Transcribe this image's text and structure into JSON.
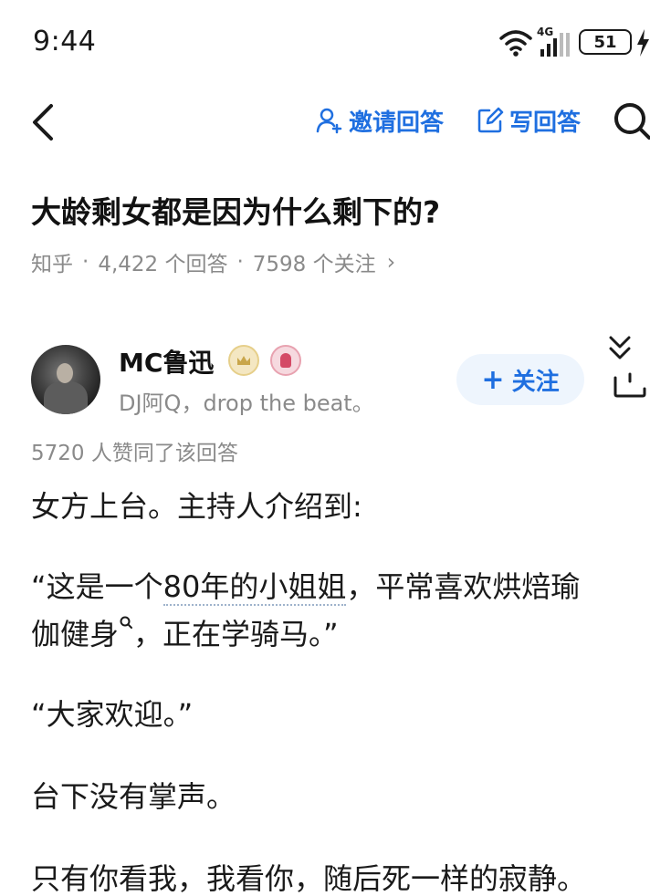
{
  "status_bar": {
    "time": "9:44",
    "network": "4G",
    "battery": "51"
  },
  "nav": {
    "invite_label": "邀请回答",
    "write_label": "写回答"
  },
  "question": {
    "title": "大龄剩女都是因为什么剩下的?",
    "source": "知乎",
    "answers": "4,422 个回答",
    "followers": "7598 个关注",
    "separator": "·",
    "chevron": "›"
  },
  "answer": {
    "author_name": "MC鲁迅",
    "author_bio": "DJ阿Q，drop the beat。",
    "follow_label": "关注",
    "follow_plus": "+",
    "upvotes": "5720 人赞同了该回答",
    "paragraphs": {
      "p1": "女方上台。主持人介绍到:",
      "p2_prefix": "“这是一个",
      "p2_link": "80年的小姐姐",
      "p2_suffix": "，平常喜欢烘焙瑜",
      "p3_prefix": "伽健身",
      "p3_suffix": "，正在学骑马。”",
      "p4": "“大家欢迎。”",
      "p5": "台下没有掌声。",
      "p6": "只有你看我，我看你，随后死一样的寂静。"
    }
  },
  "colors": {
    "accent": "#1f6fe0",
    "muted": "#8a8a8a",
    "text": "#1a1a1a",
    "follow_bg": "#eef5fd"
  },
  "icons": [
    "wifi-icon",
    "signal-icon",
    "battery-icon",
    "charge-icon",
    "back-icon",
    "invite-user-icon",
    "edit-icon",
    "search-icon",
    "crown-badge-icon",
    "mic-badge-icon",
    "collapse-icon",
    "more-icon",
    "search-hint-icon"
  ]
}
